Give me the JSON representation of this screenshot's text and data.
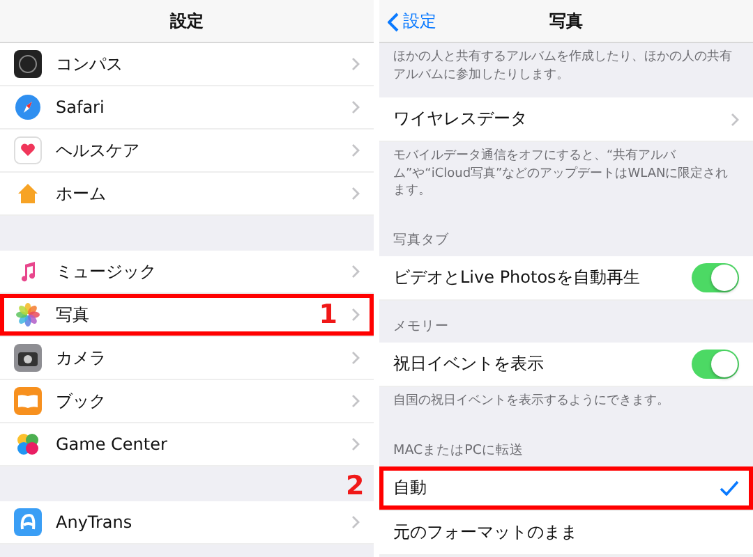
{
  "left": {
    "title": "設定",
    "groups": [
      {
        "items": [
          {
            "label": "コンパス",
            "highlighted": false
          },
          {
            "label": "Safari",
            "highlighted": false
          },
          {
            "label": "ヘルスケア",
            "highlighted": false
          },
          {
            "label": "ホーム",
            "highlighted": false
          }
        ]
      },
      {
        "items": [
          {
            "label": "ミュージック",
            "highlighted": false
          },
          {
            "label": "写真",
            "highlighted": true,
            "marker": "1"
          },
          {
            "label": "カメラ",
            "highlighted": false
          },
          {
            "label": "ブック",
            "highlighted": false
          },
          {
            "label": "Game Center",
            "highlighted": false
          }
        ]
      },
      {
        "items": [
          {
            "label": "AnyTrans",
            "highlighted": false
          }
        ]
      }
    ]
  },
  "right": {
    "back": "設定",
    "title": "写真",
    "sections": [
      {
        "footer": "ほかの人と共有するアルバムを作成したり、ほかの人の共有アルバムに参加したりします。"
      },
      {
        "rows": [
          {
            "kind": "link",
            "label": "ワイヤレスデータ",
            "highlighted": false
          }
        ],
        "footer": "モバイルデータ通信をオフにすると、“共有アルバム”や“iCloud写真”などのアップデートはWLANに限定されます。"
      },
      {
        "header": "写真タブ",
        "rows": [
          {
            "kind": "toggle",
            "label": "ビデオとLive Photosを自動再生",
            "on": true,
            "highlighted": false
          }
        ]
      },
      {
        "header": "メモリー",
        "rows": [
          {
            "kind": "toggle",
            "label": "祝日イベントを表示",
            "on": true,
            "highlighted": false
          }
        ],
        "footer": "自国の祝日イベントを表示するようにできます。"
      },
      {
        "header": "MACまたはPCに転送",
        "rows": [
          {
            "kind": "option",
            "label": "自動",
            "selected": true,
            "highlighted": true,
            "marker": "2"
          },
          {
            "kind": "option",
            "label": "元のフォーマットのまま",
            "selected": false,
            "highlighted": false
          }
        ]
      }
    ]
  }
}
